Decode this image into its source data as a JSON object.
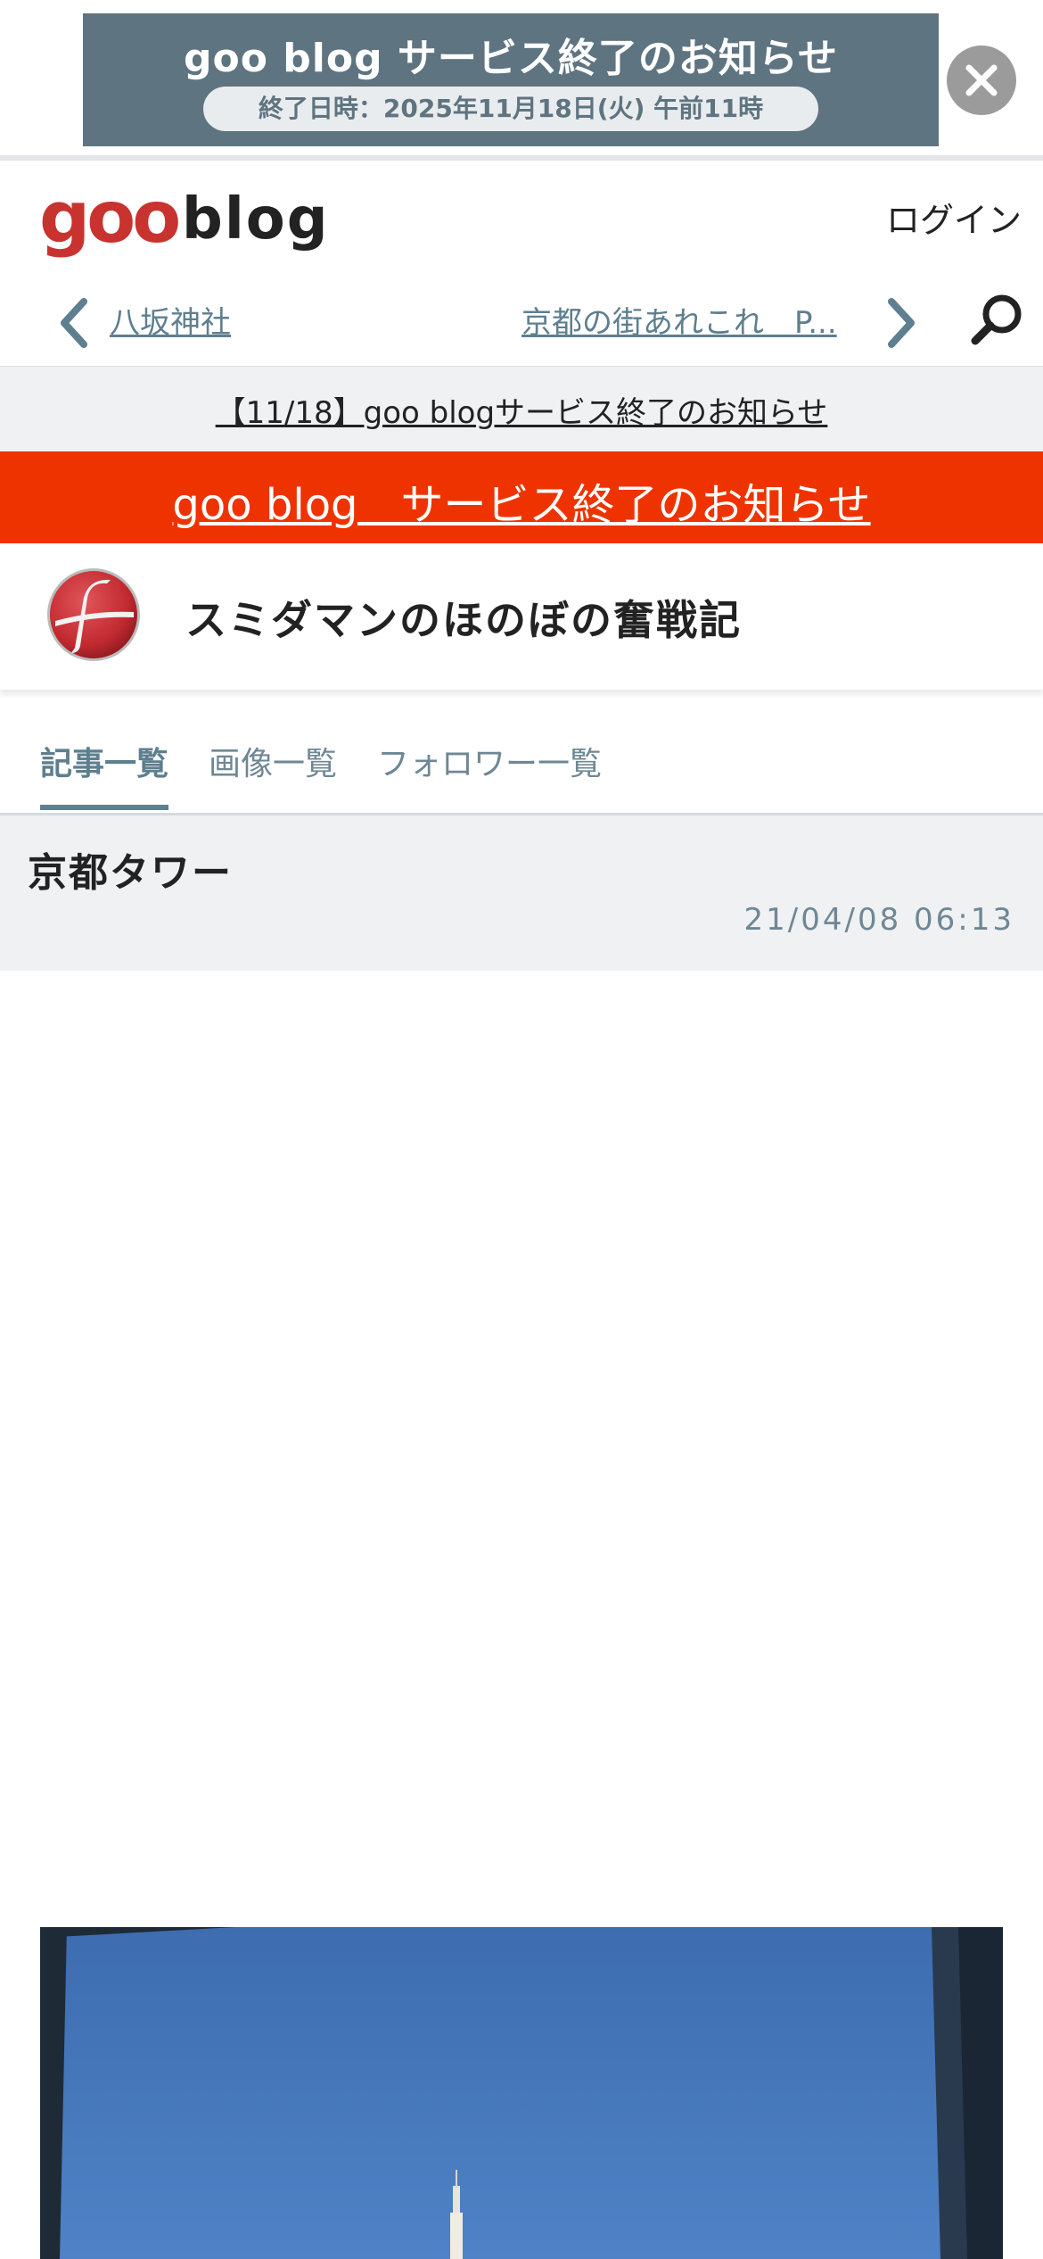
{
  "promo_banner": {
    "title": "goo blog サービス終了のお知らせ",
    "subtitle": "終了日時：2025年11月18日(火) 午前11時"
  },
  "header": {
    "logo_goo": "goo",
    "logo_blog": "blog",
    "login_label": "ログイン"
  },
  "article_nav": {
    "prev_label": "八坂神社",
    "next_label": "京都の街あれこれ　P..."
  },
  "notice": {
    "link_text": "【11/18】goo blogサービス終了のお知らせ"
  },
  "red_banner": {
    "link_text": "goo blog　サービス終了のお知らせ"
  },
  "blog": {
    "title": "スミダマンのほのぼの奮戦記"
  },
  "tabs": [
    {
      "label": "記事一覧",
      "active": true
    },
    {
      "label": "画像一覧",
      "active": false
    },
    {
      "label": "フォロワー一覧",
      "active": false
    }
  ],
  "article": {
    "title": "京都タワー",
    "date": "21/04/08 06:13"
  },
  "colors": {
    "accent": "#5e7f8f",
    "brand_red": "#c9332f",
    "alert_red": "#ee3300",
    "promo_bg": "#5e7480"
  },
  "icons": {
    "close": "close-icon",
    "prev": "chevron-left-icon",
    "next": "chevron-right-icon",
    "search": "search-icon"
  }
}
